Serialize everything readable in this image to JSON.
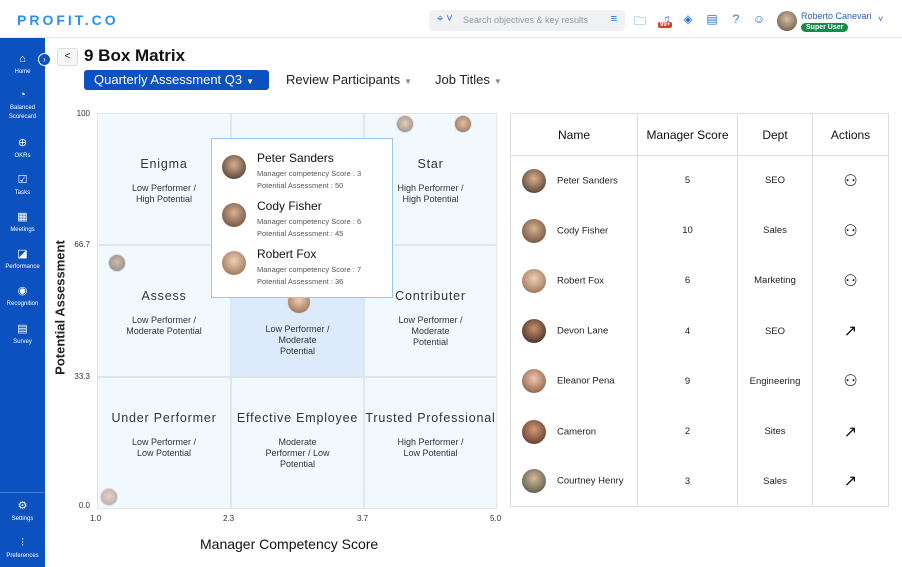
{
  "header": {
    "logo": "PROFIT.CO",
    "search_placeholder": "Search objectives & key results",
    "notification_badge": "99+",
    "user_name": "Roberto Canevari",
    "user_role": "Super User"
  },
  "sidebar": {
    "items": [
      {
        "label": "Home",
        "icon": "home-icon"
      },
      {
        "label": "Balanced Scorecard",
        "icon": "gauge-icon"
      },
      {
        "label": "OKRs",
        "icon": "target-icon"
      },
      {
        "label": "Tasks",
        "icon": "tasks-icon"
      },
      {
        "label": "Meetings",
        "icon": "calendar-icon"
      },
      {
        "label": "Performance",
        "icon": "chart-icon"
      },
      {
        "label": "Recognition",
        "icon": "chat-icon"
      },
      {
        "label": "Survey",
        "icon": "survey-icon"
      }
    ],
    "bottom": [
      {
        "label": "Settings",
        "icon": "gear-icon"
      },
      {
        "label": "Preferences",
        "icon": "sliders-icon"
      }
    ]
  },
  "page": {
    "back_label": "<",
    "title": "9 Box Matrix",
    "filters": [
      {
        "label": "Quarterly Assessment Q3"
      },
      {
        "label": "Review Participants"
      },
      {
        "label": "Job Titles"
      }
    ]
  },
  "matrix": {
    "y_label": "Potential Assessment",
    "x_label": "Manager Competency Score",
    "y_ticks": [
      "100",
      "66.7",
      "33.3",
      "0.0"
    ],
    "x_ticks": [
      "1.0",
      "2.3",
      "3.7",
      "5.0"
    ],
    "cells": [
      {
        "title": "Enigma",
        "sub": "Low Performer / High Potential"
      },
      {
        "title": "",
        "sub": ""
      },
      {
        "title": "Star",
        "sub": "High Performer / High Potential"
      },
      {
        "title": "Assess",
        "sub": "Low Performer / Moderate Potential"
      },
      {
        "title": "",
        "sub": "Low Performer / Moderate Potential"
      },
      {
        "title": "Contributer",
        "sub": "Low Performer / Moderate Potential"
      },
      {
        "title": "Under Performer",
        "sub": "Low Performer / Low Potential"
      },
      {
        "title": "Effective Employee",
        "sub": "Moderate Performer / Low Potential"
      },
      {
        "title": "Trusted Professional",
        "sub": "High Performer / Low Potential"
      }
    ],
    "tooltip": [
      {
        "name": "Peter Sanders",
        "score": "Manager competency Score : 3",
        "potential": "Potential Assessment : 50"
      },
      {
        "name": "Cody Fisher",
        "score": "Manager competency Score : 6",
        "potential": "Potential Assessment : 45"
      },
      {
        "name": "Robert Fox",
        "score": "Manager competency Score : 7",
        "potential": "Potential Assessment : 36"
      }
    ]
  },
  "table": {
    "headers": [
      "Name",
      "Manager Score",
      "Dept",
      "Actions"
    ],
    "rows": [
      {
        "name": "Peter Sanders",
        "score": "5",
        "dept": "SEO",
        "action": "user-settings-icon"
      },
      {
        "name": "Cody Fisher",
        "score": "10",
        "dept": "Sales",
        "action": "user-settings-icon"
      },
      {
        "name": "Robert Fox",
        "score": "6",
        "dept": "Marketing",
        "action": "user-settings-icon"
      },
      {
        "name": "Devon Lane",
        "score": "4",
        "dept": "SEO",
        "action": "growth-chart-icon"
      },
      {
        "name": "Eleanor Pena",
        "score": "9",
        "dept": "Engineering",
        "action": "user-settings-icon"
      },
      {
        "name": "Cameron",
        "score": "2",
        "dept": "Sites",
        "action": "growth-chart-icon"
      },
      {
        "name": "Courtney Henry",
        "score": "3",
        "dept": "Sales",
        "action": "growth-chart-icon"
      }
    ]
  },
  "colors": {
    "brand": "#0c51c0",
    "logo": "#2a8ff0",
    "cell": "#f1f9fe",
    "highlight": "#ddeafc",
    "role_badge": "#1a8a4a"
  }
}
